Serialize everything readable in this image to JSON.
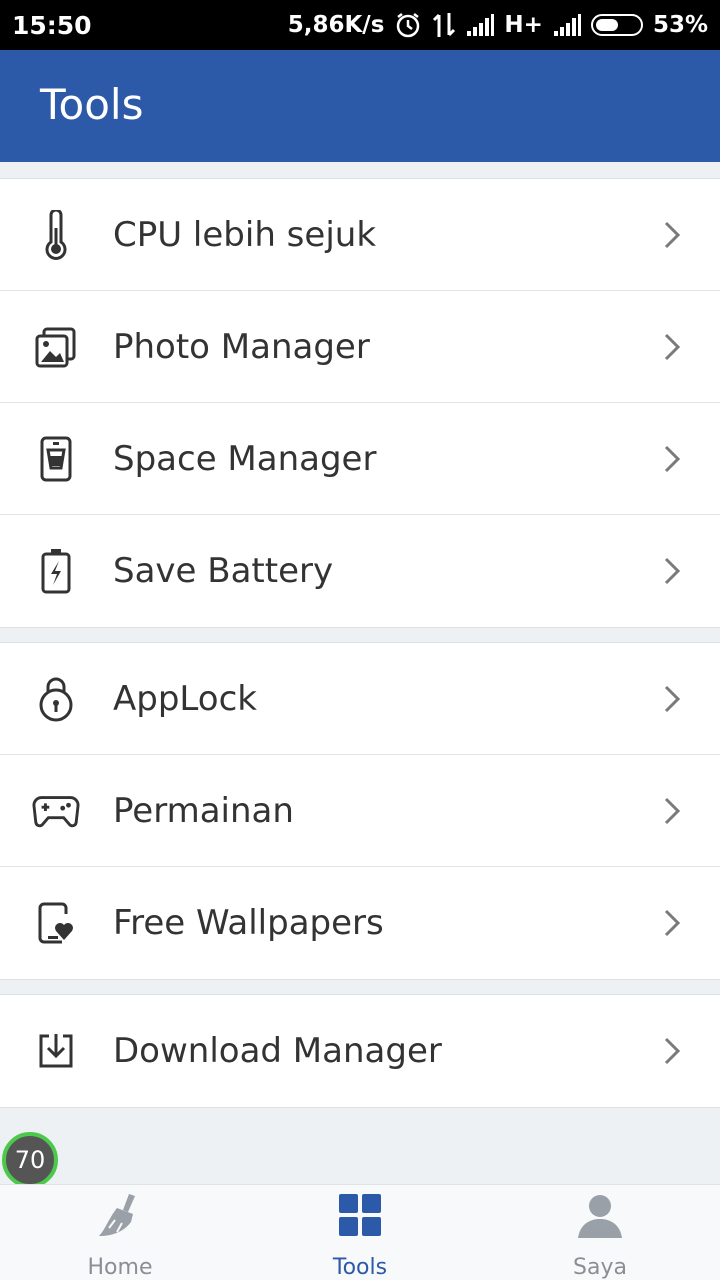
{
  "status_bar": {
    "time": "15:50",
    "speed": "5,86K/s",
    "network": "H+",
    "battery": "53%",
    "battery_level": 0.53
  },
  "app_bar": {
    "title": "Tools"
  },
  "groups": [
    {
      "items": [
        {
          "label": "CPU lebih sejuk",
          "icon": "thermometer-icon"
        },
        {
          "label": "Photo Manager",
          "icon": "photo-icon"
        },
        {
          "label": "Space Manager",
          "icon": "phone-storage-icon"
        },
        {
          "label": "Save Battery",
          "icon": "battery-icon"
        }
      ]
    },
    {
      "items": [
        {
          "label": "AppLock",
          "icon": "lock-icon"
        },
        {
          "label": "Permainan",
          "icon": "gamepad-icon"
        },
        {
          "label": "Free Wallpapers",
          "icon": "wallpaper-heart-icon"
        }
      ]
    },
    {
      "items": [
        {
          "label": "Download Manager",
          "icon": "download-icon"
        }
      ]
    }
  ],
  "floating_badge": {
    "value": "70"
  },
  "bottom_nav": {
    "items": [
      {
        "label": "Home",
        "icon": "broom-icon",
        "active": false
      },
      {
        "label": "Tools",
        "icon": "grid-icon",
        "active": true
      },
      {
        "label": "Saya",
        "icon": "user-icon",
        "active": false
      }
    ]
  },
  "colors": {
    "accent": "#2d5aa8",
    "inactive": "#8a8f96",
    "icon": "#333333",
    "chevron": "#7a7a7a",
    "badge_ring": "#4cc94a"
  }
}
